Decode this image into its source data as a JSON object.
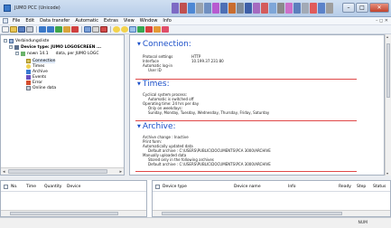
{
  "window": {
    "title": "JUMO PCC (Unicode)"
  },
  "menu": [
    "File",
    "Edit",
    "Data transfer",
    "Automatic",
    "Extras",
    "View",
    "Window",
    "Info"
  ],
  "tree": {
    "root": "Verbindungsliste",
    "device": "Device type: JUMO LOGOSCREEN ...",
    "connection": "nown 14.1",
    "connection_detail": "data, per JUMO LOGC",
    "items": [
      "Connection",
      "Times",
      "Archive",
      "Events",
      "Error",
      "Online data"
    ]
  },
  "sections": {
    "connection": {
      "title": "Connection:",
      "rows": [
        {
          "label": "Protocol settings",
          "value": "HTTP"
        },
        {
          "label": "Interface",
          "value": "10.199.37.231:80"
        },
        {
          "label": "Automatic log-in",
          "value": ""
        },
        {
          "label": "User ID",
          "value": ""
        }
      ]
    },
    "times": {
      "title": "Times:",
      "lines": [
        "Cyclical system process:",
        "Automatic is switched off",
        "Operating time: 24 hrs per day",
        "Only on weekdays:",
        "Sunday, Monday, Tuesday, Wednesday, Thursday, Friday, Saturday"
      ]
    },
    "archive": {
      "title": "Archive:",
      "lines": [
        "Archive change : Inactive",
        "Print form:",
        "Automatically updated data",
        "Default archive : C:\\USERS\\PUBLIC\\DOCUMENTS\\PCA 3000\\ARCHIVE",
        "Manually uploaded data",
        "Stored only in the following archives",
        "Default archive : C:\\USERS\\PUBLIC\\DOCUMENTS\\PCA 3000\\ARCHIVE"
      ]
    }
  },
  "bottom_left": {
    "columns": [
      "No.",
      "Time",
      "Quantity",
      "Device"
    ]
  },
  "bottom_right": {
    "columns": [
      "Device type",
      "Device name",
      "Info",
      "Ready",
      "Step",
      "Status"
    ]
  },
  "status": {
    "zoom": "NUM"
  }
}
